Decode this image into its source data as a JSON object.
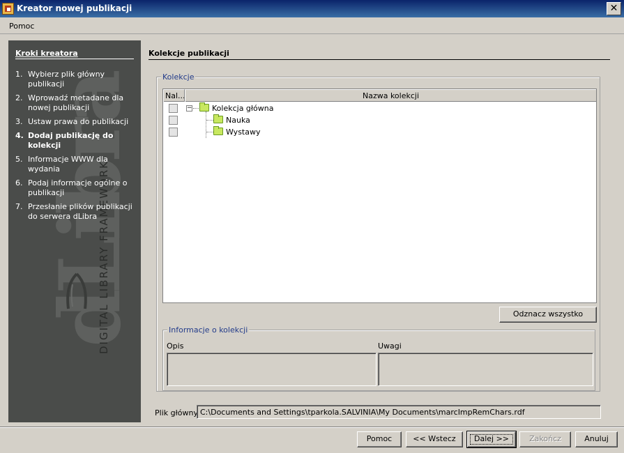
{
  "window": {
    "title": "Kreator nowej publikacji",
    "close_glyph": "✕"
  },
  "menu": {
    "items": [
      "Pomoc"
    ]
  },
  "sidebar": {
    "heading": "Kroki kreatora",
    "watermark_text": "DIGITAL LIBRARY FRAMEWORK",
    "watermark_logo": "dLibra",
    "steps": [
      {
        "num": "1.",
        "label": "Wybierz plik główny publikacji",
        "active": false
      },
      {
        "num": "2.",
        "label": "Wprowadź metadane dla nowej publikacji",
        "active": false
      },
      {
        "num": "3.",
        "label": "Ustaw prawa do publikacji",
        "active": false
      },
      {
        "num": "4.",
        "label": "Dodaj publikację do kolekcji",
        "active": true
      },
      {
        "num": "5.",
        "label": "Informacje WWW dla wydania",
        "active": false
      },
      {
        "num": "6.",
        "label": "Podaj informacje ogólne o publikacji",
        "active": false
      },
      {
        "num": "7.",
        "label": "Przesłanie plików publikacji do serwera dLibra",
        "active": false
      }
    ]
  },
  "content": {
    "section_title": "Kolekcje publikacji",
    "collections_group": {
      "legend": "Kolekcje",
      "columns": [
        "Nal...",
        "Nazwa kolekcji"
      ],
      "tree": [
        {
          "label": "Kolekcja główna",
          "expanded": true,
          "checked": false
        },
        {
          "label": "Nauka",
          "checked": false
        },
        {
          "label": "Wystawy",
          "checked": false
        }
      ],
      "expander_glyph": "−",
      "deselect_all_button": "Odznacz wszystko"
    },
    "info_group": {
      "legend": "Informacje o kolekcji",
      "description_label": "Opis",
      "notes_label": "Uwagi",
      "description_value": "",
      "notes_value": ""
    },
    "main_file": {
      "label": "Plik główny",
      "value": "C:\\Documents and Settings\\tparkola.SALVINIA\\My Documents\\marcImpRemChars.rdf"
    }
  },
  "buttons": {
    "help": "Pomoc",
    "back": "<< Wstecz",
    "next": "Dalej >>",
    "finish": "Zakończ",
    "cancel": "Anuluj"
  }
}
